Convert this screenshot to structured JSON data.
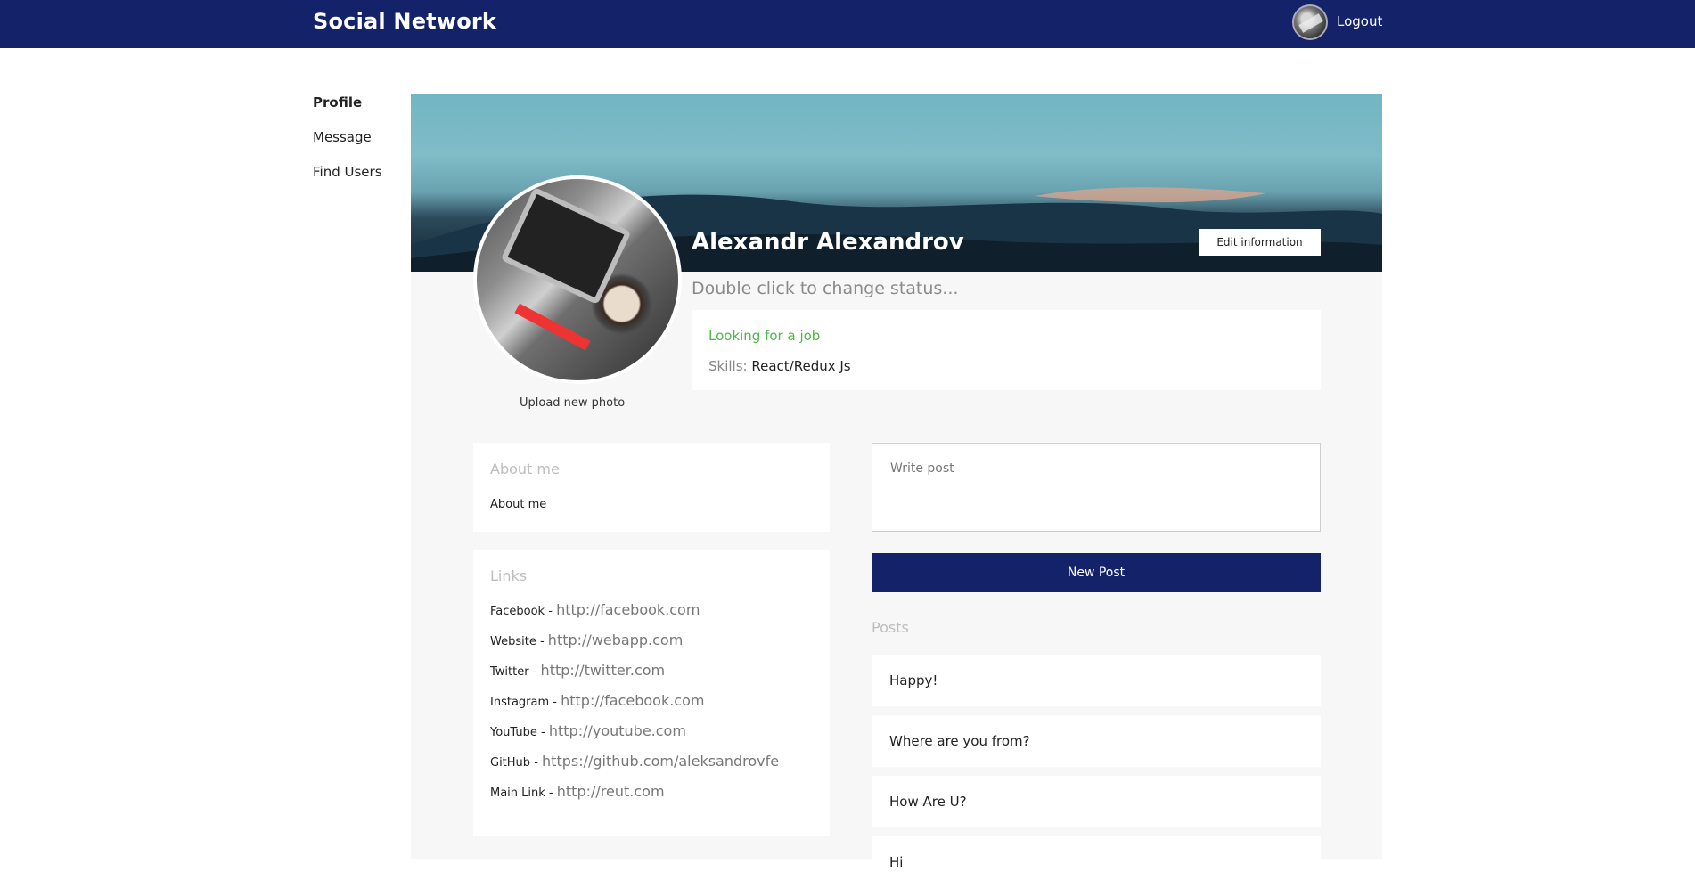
{
  "header": {
    "brand": "Social Network",
    "logout_label": "Logout",
    "avatar_icon": "user-avatar"
  },
  "sidebar": {
    "items": [
      {
        "label": "Profile",
        "active": true
      },
      {
        "label": "Message",
        "active": false
      },
      {
        "label": "Find Users",
        "active": false
      }
    ]
  },
  "profile": {
    "name": "Alexandr Alexandrov",
    "edit_label": "Edit information",
    "status_placeholder": "Double click to change status...",
    "upload_label": "Upload new photo",
    "job_status": "Looking for a job",
    "skills_label": "Skills:",
    "skills_value": "React/Redux Js"
  },
  "about": {
    "title": "About me",
    "text": "About me"
  },
  "links": {
    "title": "Links",
    "items": [
      {
        "name": "Facebook",
        "url": "http://facebook.com"
      },
      {
        "name": "Website",
        "url": "http://webapp.com"
      },
      {
        "name": "Twitter",
        "url": "http://twitter.com"
      },
      {
        "name": "Instagram",
        "url": "http://facebook.com"
      },
      {
        "name": "YouTube",
        "url": "http://youtube.com"
      },
      {
        "name": "GitHub",
        "url": "https://github.com/aleksandrovfe"
      },
      {
        "name": "Main Link",
        "url": "http://reut.com"
      }
    ]
  },
  "posts": {
    "input_placeholder": "Write post",
    "new_post_label": "New Post",
    "title": "Posts",
    "items": [
      "Happy!",
      "Where are you from?",
      "How Are U?",
      "Hi"
    ]
  },
  "colors": {
    "header": "#14226a",
    "job_status": "#4cb845",
    "panel": "#f7f7f7"
  }
}
